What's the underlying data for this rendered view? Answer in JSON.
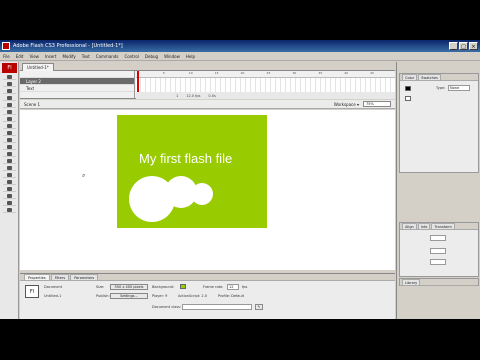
{
  "window": {
    "title": "Adobe Flash CS3 Professional - [Untitled-1*]",
    "controls": {
      "minimize": "_",
      "maximize": "□",
      "close": "×"
    }
  },
  "menubar": [
    "File",
    "Edit",
    "View",
    "Insert",
    "Modify",
    "Text",
    "Commands",
    "Control",
    "Debug",
    "Window",
    "Help"
  ],
  "tools": {
    "logo": "Fl"
  },
  "document": {
    "tab": "Untitled-1*",
    "timeline": {
      "layers": [
        {
          "name": "Layer 2",
          "selected": true
        },
        {
          "name": "Text",
          "selected": false
        }
      ],
      "ruler": [
        "1",
        "5",
        "10",
        "15",
        "20",
        "25",
        "30",
        "35",
        "40",
        "45"
      ],
      "status": {
        "frame": "1",
        "fps": "12.0 fps",
        "time": "0.0s"
      }
    },
    "editbar": {
      "scene": "Scene 1",
      "workspace": "Workspace ▾",
      "zoom": "75%"
    },
    "stage": {
      "text": "My first flash file",
      "color": "#99cc00"
    }
  },
  "properties": {
    "tabs": [
      "Properties",
      "Filters",
      "Parameters"
    ],
    "doc_label": "Document",
    "doc_name": "Untitled-1",
    "size_label": "Size:",
    "size_value": "550 x 400 pixels",
    "background_label": "Background:",
    "framerate_label": "Frame rate:",
    "framerate_value": "12",
    "fps_label": "fps",
    "publish_label": "Publish:",
    "settings_button": "Settings...",
    "player_label": "Player: 9",
    "actionscript_label": "ActionScript: 2.0",
    "profile_label": "Profile: Default",
    "docclass_label": "Document class:"
  },
  "right_panel": {
    "color_tabs": [
      "Color",
      "Swatches"
    ],
    "type_label": "Type:",
    "type_value": "None",
    "align_tabs": [
      "Align",
      "Info",
      "Transform"
    ],
    "library_tab": "Library"
  }
}
